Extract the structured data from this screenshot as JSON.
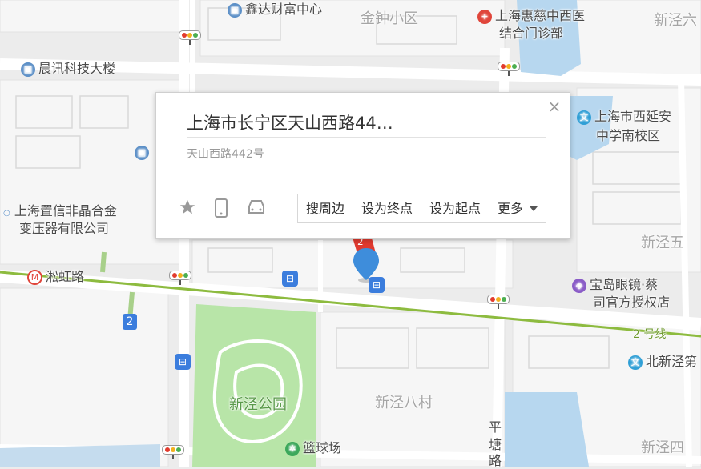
{
  "colors": {
    "map_bg": "#ececec",
    "block": "#f7f7f7",
    "road": "#ffffff",
    "park": "#b8e5a8",
    "water": "#b7d7ef",
    "metro_line": "#8dbb3f",
    "marker": "#3e8ddb",
    "marker_secondary": "#e03a2f"
  },
  "popup": {
    "title": "上海市长宁区天山西路44…",
    "address": "天山西路442号",
    "close_icon": "close-icon",
    "icons": [
      "star-icon",
      "phone-icon",
      "car-icon"
    ],
    "buttons": {
      "nearby": "搜周边",
      "destination": "设为终点",
      "origin": "设为起点",
      "more": "更多"
    }
  },
  "labels": {
    "xinda": "鑫达财富中心",
    "jinzhong": "金钟小区",
    "huici_1": "上海惠慈中西医",
    "huici_2": "结合门诊部",
    "xinjing_top": "新泾六",
    "chenxun": "晨讯科技大楼",
    "xiyanan_1": "上海市西延安",
    "xiyanan_2": "中学南校区",
    "zhixin_1": "上海置信非晶合金",
    "zhixin_2": "变压器有限公司",
    "xinjing5": "新泾五",
    "songhong": "淞虹路",
    "baodao_1": "宝岛眼镜·蔡",
    "baodao_2": "司官方授权店",
    "line2_badge": "2",
    "line2_label": "2 号线",
    "marker_badge": "2",
    "beixinjing": "北新泾第",
    "park_name": "新泾公园",
    "xinjing8": "新泾八村",
    "court": "篮球场",
    "pingtang_1": "平",
    "pingtang_2": "塘",
    "pingtang_3": "路",
    "xinjing4": "新泾四"
  }
}
